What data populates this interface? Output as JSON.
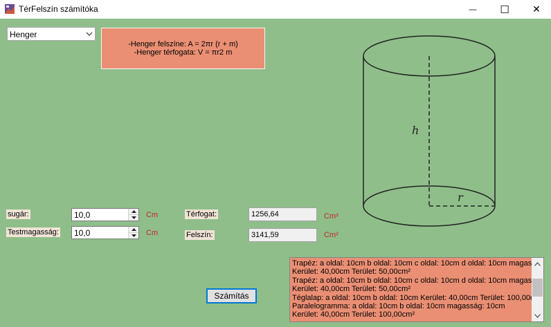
{
  "window": {
    "title": "TérFelszín számítóka",
    "minimize_glyph": "—",
    "maximize_glyph": "☐",
    "close_glyph": "✕"
  },
  "shape_select": {
    "selected": "Henger"
  },
  "formula": {
    "line1": "-Henger felszíne: A = 2πr (r + m)",
    "line2": "-Henger térfogata: V = πr2 m"
  },
  "inputs": {
    "radius_label": "sugár:",
    "radius_value": "10,0",
    "radius_unit": "Cm",
    "height_label": "Testmagasság:",
    "height_value": "10,0",
    "height_unit": "Cm"
  },
  "outputs": {
    "volume_label": "Térfogat:",
    "volume_value": "1256,64",
    "volume_unit": "Cm³",
    "surface_label": "Felszín:",
    "surface_value": "3141,59",
    "surface_unit": "Cm²"
  },
  "diagram": {
    "height_label": "h",
    "radius_label": "r"
  },
  "history": {
    "lines": [
      "Trapéz: a oldal: 10cm b oldal: 10cm c oldal: 10cm d oldal: 10cm magasság: 10cm",
      "Kerület: 40,00cm Terület: 50,00cm²",
      "Trapéz: a oldal: 10cm b oldal: 10cm c oldal: 10cm d oldal: 10cm magasság: 10cm",
      "Kerület: 40,00cm Terület: 50,00cm²",
      "Téglalap: a oldal: 10cm b oldal: 10cm Kerület: 40,00cm Terület: 100,00cm²",
      "Paralelogramma: a oldal: 10cm b oldal: 10cm magasság: 10cm",
      "Kerület: 40,00cm Terület: 100,00cm²"
    ]
  },
  "calculate_button": {
    "label": "Számítás"
  }
}
